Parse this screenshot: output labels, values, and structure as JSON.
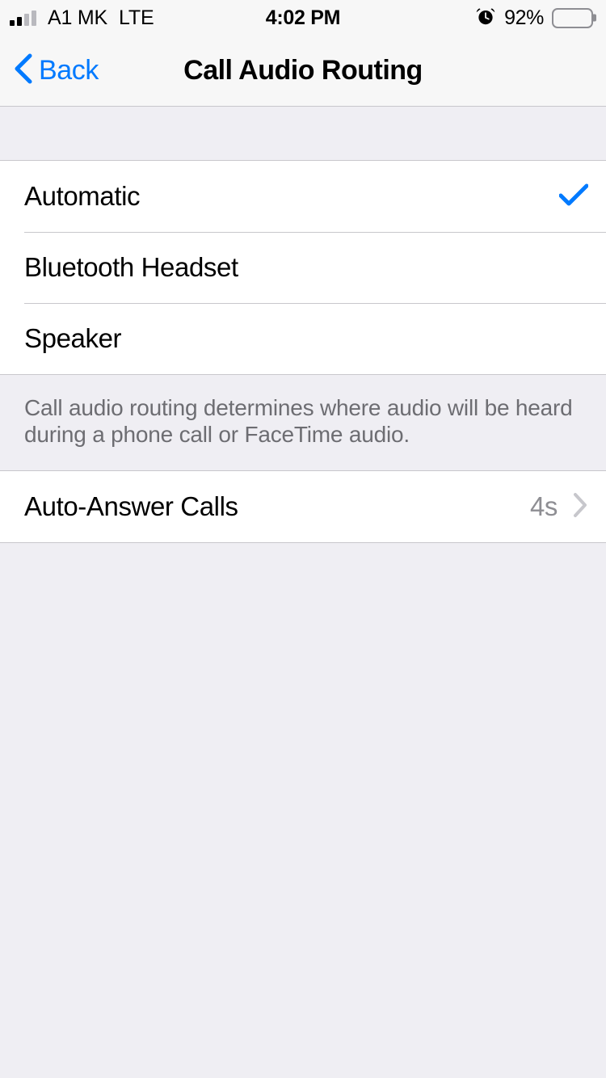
{
  "status_bar": {
    "carrier": "A1 MK",
    "network": "LTE",
    "time": "4:02 PM",
    "battery_percent": "92%",
    "signal_bars_filled": 2,
    "signal_bars_total": 4,
    "alarm_icon": "alarm-clock-icon",
    "battery_icon": "battery-icon"
  },
  "nav_bar": {
    "back_label": "Back",
    "back_icon": "chevron-left-icon",
    "title": "Call Audio Routing"
  },
  "routing_options": [
    {
      "label": "Automatic",
      "selected": true
    },
    {
      "label": "Bluetooth Headset",
      "selected": false
    },
    {
      "label": "Speaker",
      "selected": false
    }
  ],
  "footer_note": "Call audio routing determines where audio will be heard during a phone call or FaceTime audio.",
  "auto_answer": {
    "label": "Auto-Answer Calls",
    "value": "4s",
    "disclosure_icon": "chevron-right-icon"
  },
  "colors": {
    "accent": "#007AFF",
    "background": "#EFEEF3",
    "row_background": "#FFFFFF",
    "separator": "#C8C7CC",
    "secondary_text": "#8E8E93",
    "footer_text": "#6D6D72",
    "bar_background": "#F7F7F7"
  }
}
